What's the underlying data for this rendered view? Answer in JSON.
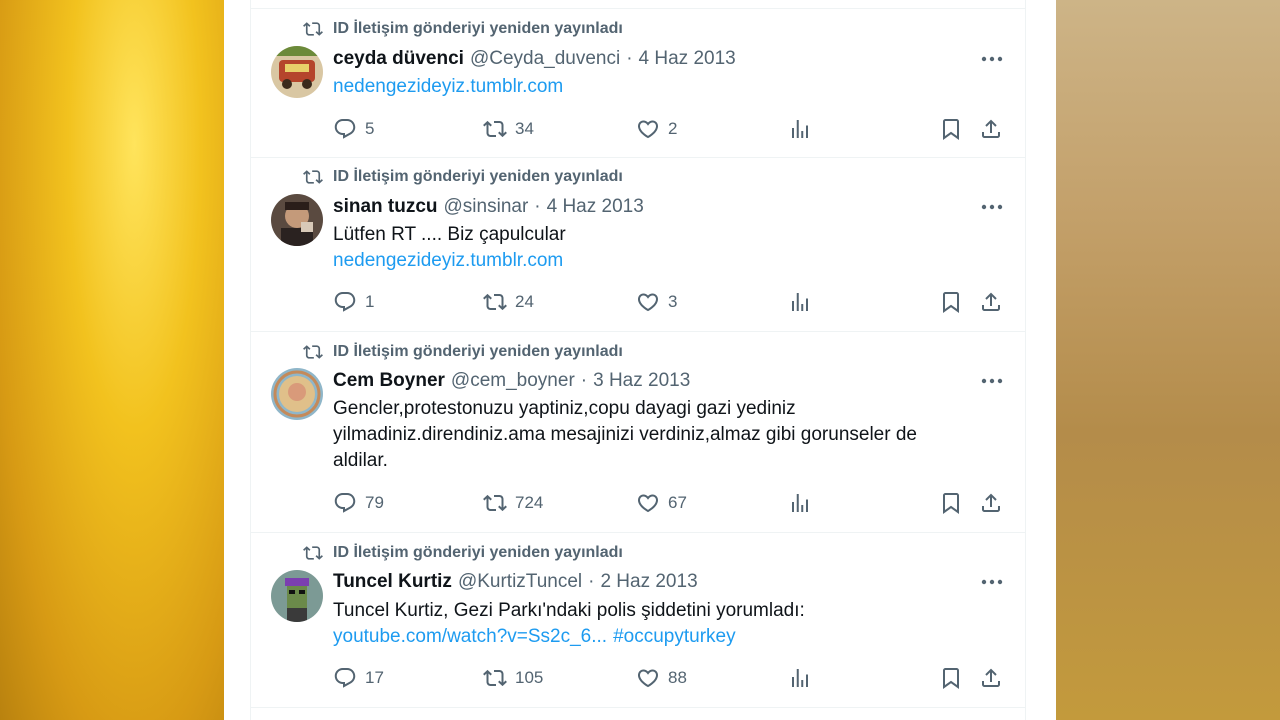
{
  "retweet_label": "ID İletişim gönderiyi yeniden yayınladı",
  "tweets": [
    {
      "name": "ceyda düvenci",
      "handle": "@Ceyda_duvenci",
      "date": "4 Haz 2013",
      "text": "",
      "link": "nedengezideyiz.tumblr.com",
      "hashtag": "",
      "replies": "5",
      "retweets": "34",
      "likes": "2",
      "avatar_color": "#8b5a2b"
    },
    {
      "name": "sinan tuzcu",
      "handle": "@sinsinar",
      "date": "4 Haz 2013",
      "text": "Lütfen RT .... Biz çapulcular",
      "link": "nedengezideyiz.tumblr.com",
      "hashtag": "",
      "replies": "1",
      "retweets": "24",
      "likes": "3",
      "avatar_color": "#3a2e2a"
    },
    {
      "name": "Cem Boyner",
      "handle": "@cem_boyner",
      "date": "3 Haz 2013",
      "text": "Gencler,protestonuzu yaptiniz,copu dayagi gazi yediniz yilmadiniz.direndiniz.ama mesajinizi verdiniz,almaz gibi gorunseler de aldilar.",
      "link": "",
      "hashtag": "",
      "replies": "79",
      "retweets": "724",
      "likes": "67",
      "avatar_color": "#c9a77a"
    },
    {
      "name": "Tuncel Kurtiz",
      "handle": "@KurtizTuncel",
      "date": "2 Haz 2013",
      "text": "Tuncel Kurtiz, Gezi Parkı'ndaki polis şiddetini yorumladı:",
      "link": "youtube.com/watch?v=Ss2c_6...",
      "hashtag": "#occupyturkey",
      "replies": "17",
      "retweets": "105",
      "likes": "88",
      "avatar_color": "#6f8f8a"
    }
  ],
  "colors": {
    "text": "#0f1419",
    "muted": "#536471",
    "link": "#1d9bf0",
    "divider": "#eff3f4"
  }
}
